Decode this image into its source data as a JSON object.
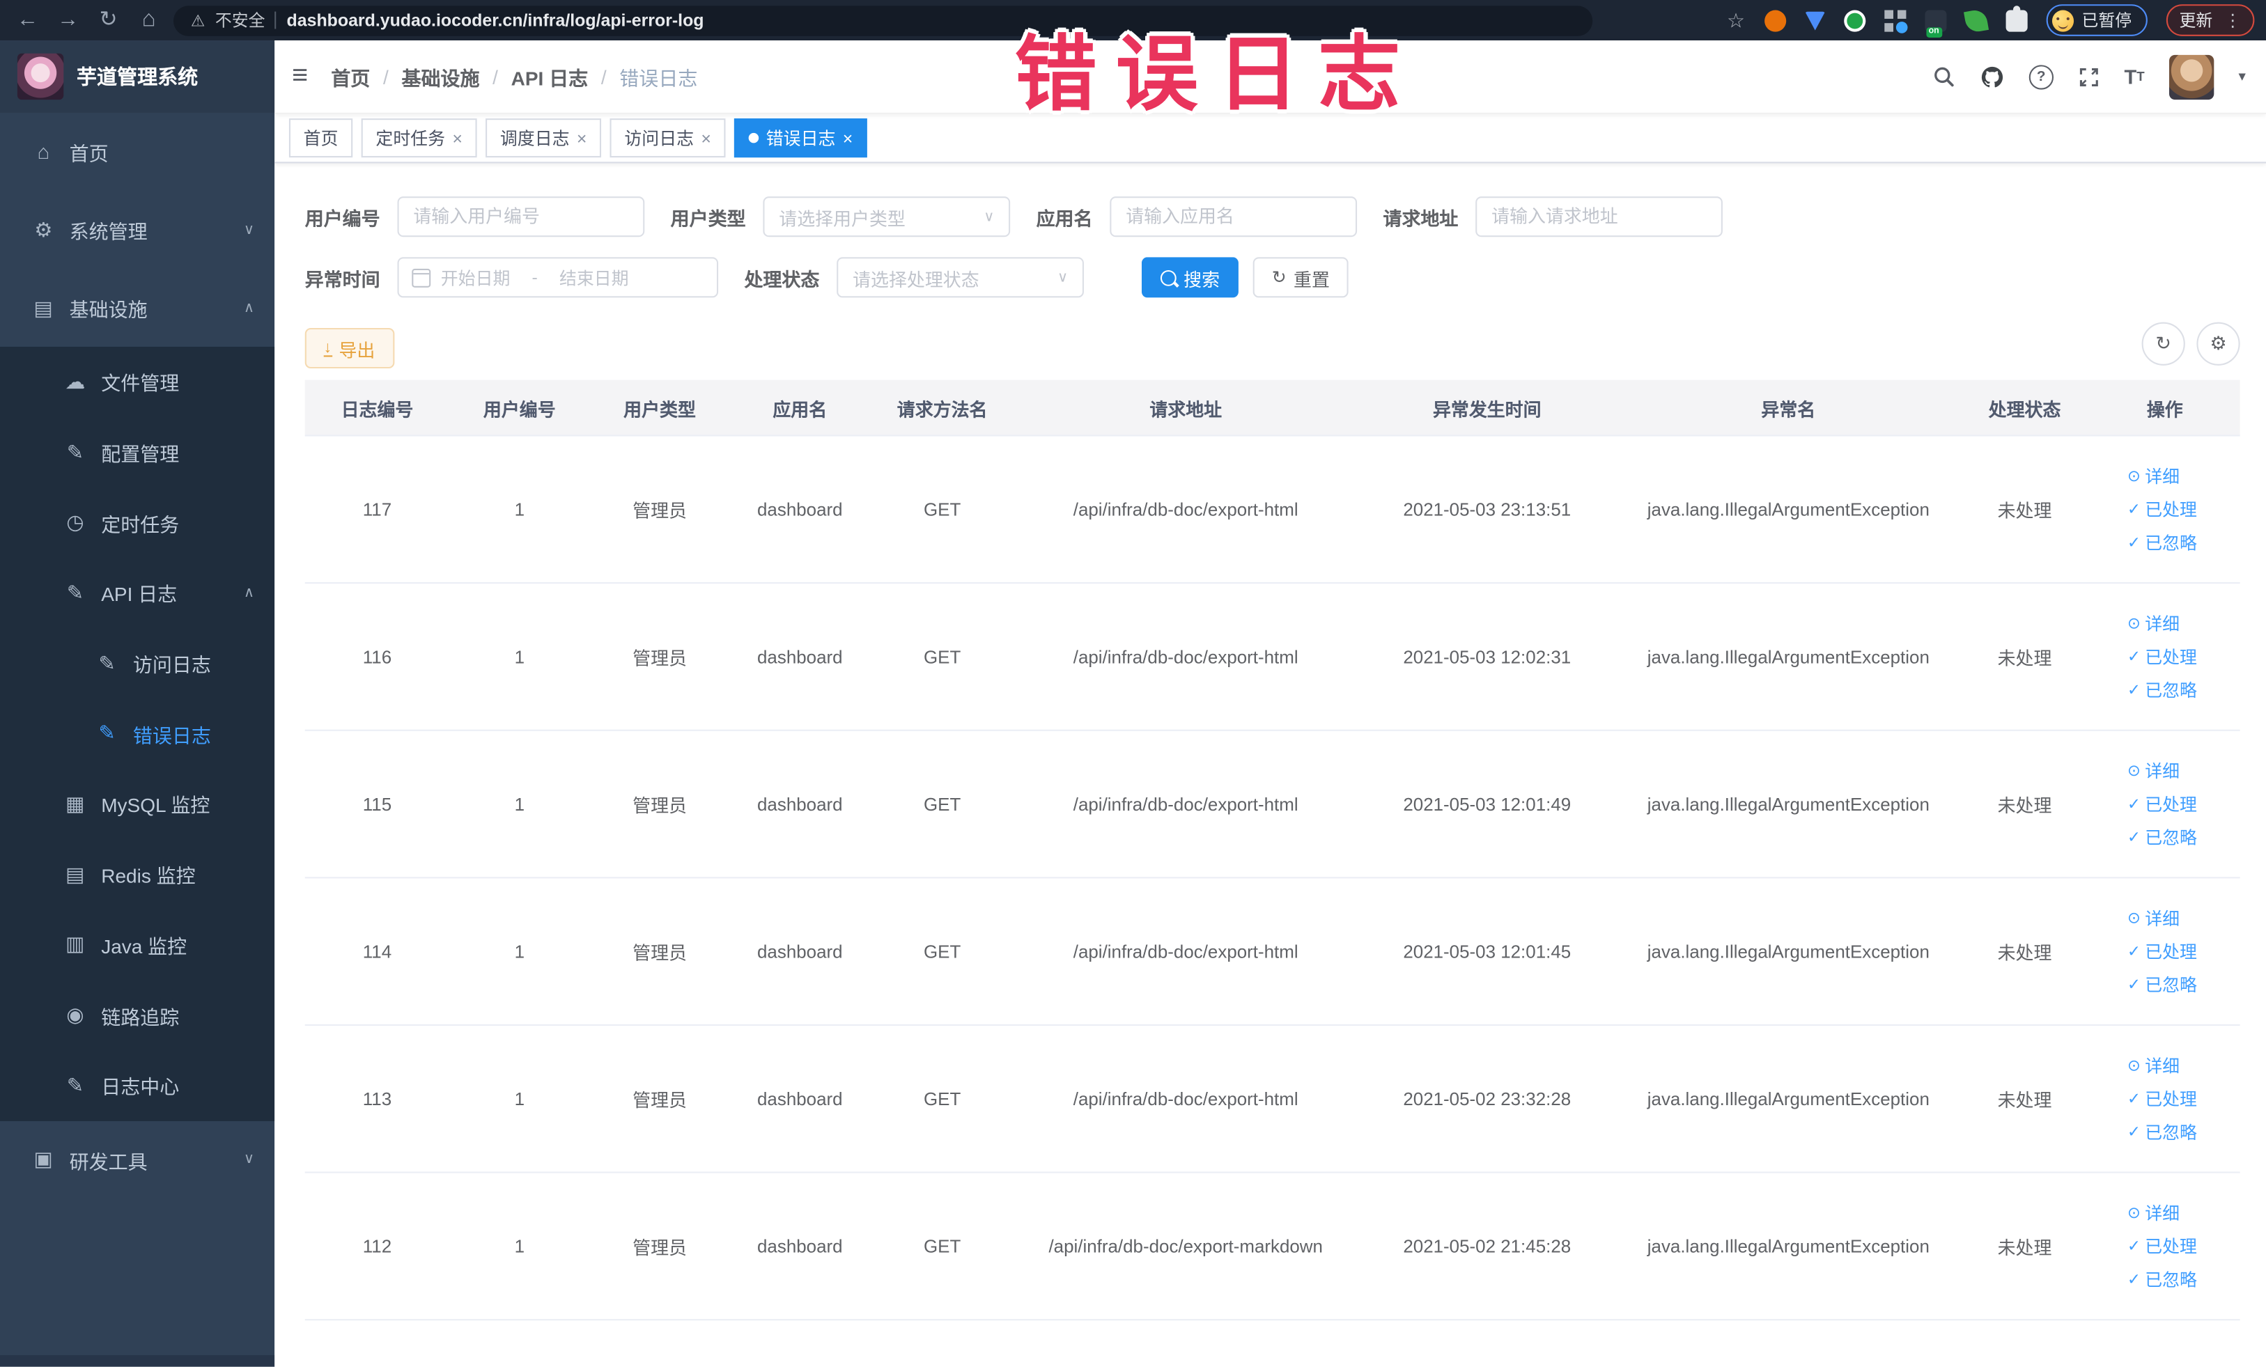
{
  "watermark": {
    "text": "错误日志",
    "color": "#e9345c"
  },
  "browser": {
    "security_label": "不安全",
    "url": "dashboard.yudao.iocoder.cn/infra/log/api-error-log",
    "proxy_on_label": "on",
    "paused_chip_label": "已暂停",
    "update_label": "更新",
    "icons": [
      "back-arrow",
      "forward-arrow",
      "reload",
      "home",
      "warning-triangle",
      "bookmark-star",
      "adblock",
      "shield",
      "green-v",
      "grid-apps",
      "proxy-on",
      "leaf",
      "extensions-puzzle",
      "menu-dots"
    ]
  },
  "sidebar": {
    "title": "芋道管理系统",
    "items": [
      {
        "label": "首页"
      },
      {
        "label": "系统管理",
        "chevron": "down"
      },
      {
        "label": "基础设施",
        "chevron": "up"
      }
    ],
    "infra_children": [
      {
        "label": "文件管理"
      },
      {
        "label": "配置管理"
      },
      {
        "label": "定时任务"
      },
      {
        "label": "API 日志",
        "chevron": "up"
      },
      {
        "label": "访问日志",
        "nested": true
      },
      {
        "label": "错误日志",
        "nested": true,
        "active": true
      },
      {
        "label": "MySQL 监控"
      },
      {
        "label": "Redis 监控"
      },
      {
        "label": "Java 监控"
      },
      {
        "label": "链路追踪"
      },
      {
        "label": "日志中心"
      }
    ],
    "dev_tools": {
      "label": "研发工具",
      "chevron": "down"
    }
  },
  "navbar": {
    "breadcrumb": [
      "首页",
      "基础设施",
      "API 日志",
      "错误日志"
    ],
    "icons": [
      "search",
      "github",
      "help",
      "fullscreen",
      "font-size",
      "avatar",
      "caret-down"
    ]
  },
  "tabs": [
    {
      "label": "首页",
      "closable": false,
      "active": false
    },
    {
      "label": "定时任务",
      "closable": true,
      "active": false
    },
    {
      "label": "调度日志",
      "closable": true,
      "active": false
    },
    {
      "label": "访问日志",
      "closable": true,
      "active": false
    },
    {
      "label": "错误日志",
      "closable": true,
      "active": true
    }
  ],
  "filters": {
    "user_id": {
      "label": "用户编号",
      "placeholder": "请输入用户编号",
      "value": ""
    },
    "user_type": {
      "label": "用户类型",
      "placeholder": "请选择用户类型"
    },
    "app_name": {
      "label": "应用名",
      "placeholder": "请输入应用名",
      "value": ""
    },
    "request_url": {
      "label": "请求地址",
      "placeholder": "请输入请求地址",
      "value": ""
    },
    "exception_time": {
      "label": "异常时间",
      "start_placeholder": "开始日期",
      "separator": "-",
      "end_placeholder": "结束日期"
    },
    "process_status": {
      "label": "处理状态",
      "placeholder": "请选择处理状态"
    },
    "search_label": "搜索",
    "reset_label": "重置",
    "export_label": "导出"
  },
  "table": {
    "columns": [
      "日志编号",
      "用户编号",
      "用户类型",
      "应用名",
      "请求方法名",
      "请求地址",
      "异常发生时间",
      "异常名",
      "处理状态",
      "操作"
    ],
    "row_actions": {
      "detail": "详细",
      "processed": "已处理",
      "ignored": "已忽略"
    },
    "rows": [
      {
        "id": "117",
        "user_id": "1",
        "user_type": "管理员",
        "app": "dashboard",
        "method": "GET",
        "url": "/api/infra/db-doc/export-html",
        "time": "2021-05-03 23:13:51",
        "exception": "java.lang.IllegalArgumentException",
        "status": "未处理"
      },
      {
        "id": "116",
        "user_id": "1",
        "user_type": "管理员",
        "app": "dashboard",
        "method": "GET",
        "url": "/api/infra/db-doc/export-html",
        "time": "2021-05-03 12:02:31",
        "exception": "java.lang.IllegalArgumentException",
        "status": "未处理"
      },
      {
        "id": "115",
        "user_id": "1",
        "user_type": "管理员",
        "app": "dashboard",
        "method": "GET",
        "url": "/api/infra/db-doc/export-html",
        "time": "2021-05-03 12:01:49",
        "exception": "java.lang.IllegalArgumentException",
        "status": "未处理"
      },
      {
        "id": "114",
        "user_id": "1",
        "user_type": "管理员",
        "app": "dashboard",
        "method": "GET",
        "url": "/api/infra/db-doc/export-html",
        "time": "2021-05-03 12:01:45",
        "exception": "java.lang.IllegalArgumentException",
        "status": "未处理"
      },
      {
        "id": "113",
        "user_id": "1",
        "user_type": "管理员",
        "app": "dashboard",
        "method": "GET",
        "url": "/api/infra/db-doc/export-html",
        "time": "2021-05-02 23:32:28",
        "exception": "java.lang.IllegalArgumentException",
        "status": "未处理"
      },
      {
        "id": "112",
        "user_id": "1",
        "user_type": "管理员",
        "app": "dashboard",
        "method": "GET",
        "url": "/api/infra/db-doc/export-markdown",
        "time": "2021-05-02 21:45:28",
        "exception": "java.lang.IllegalArgumentException",
        "status": "未处理"
      }
    ]
  },
  "colors": {
    "primary": "#409eff",
    "active_tab": "#1f8beb",
    "sidebar_bg": "#304156",
    "submenu_bg": "#1f2d3d",
    "warning_btn_text": "#e6a23c",
    "watermark": "#e9345c"
  }
}
